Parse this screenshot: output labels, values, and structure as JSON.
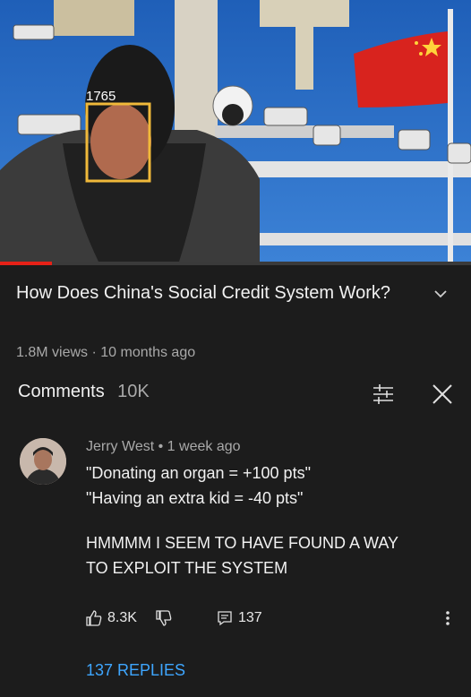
{
  "video": {
    "title": "How Does China's Social Credit System Work?",
    "views": "1.8M views",
    "separator": "·",
    "age": "10 months ago",
    "progress_fraction": 0.11,
    "face_tag_number": "1765"
  },
  "comments_header": {
    "label": "Comments",
    "count": "10K"
  },
  "comment": {
    "author": "Jerry West",
    "dot": "•",
    "time": "1 week ago",
    "line1": "\"Donating an organ = +100 pts\"",
    "line2": "\"Having an extra kid = -40 pts\"",
    "line3": "HMMMM I SEEM TO HAVE FOUND A WAY",
    "line4": "TO EXPLOIT THE SYSTEM",
    "likes": "8.3K",
    "reply_count": "137",
    "replies_link": "137 REPLIES"
  },
  "colors": {
    "background": "#1c1c1c",
    "link_blue": "#3ea6ff",
    "progress_red": "#e62117",
    "face_box": "#f0b93a",
    "sky_blue": "#2a6fc7"
  },
  "icons": [
    "chevron-down-icon",
    "sort-icon",
    "close-icon",
    "thumbs-up-icon",
    "thumbs-down-icon",
    "reply-icon",
    "more-vert-icon"
  ]
}
